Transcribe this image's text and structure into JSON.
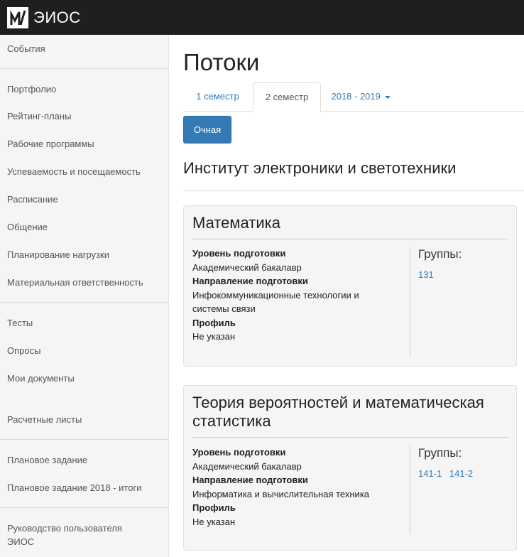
{
  "header": {
    "brand": "ЭИОС"
  },
  "sidebar": {
    "items": [
      "События",
      "Портфолио",
      "Рейтинг-планы",
      "Рабочие программы",
      "Успеваемость и посещаемость",
      "Расписание",
      "Общение",
      "Планирование нагрузки",
      "Материальная ответственность",
      "Тесты",
      "Опросы",
      "Мои документы",
      "Расчетные листы",
      "Плановое задание",
      "Плановое задание 2018 - итоги",
      "Руководство пользователя ЭИОС"
    ]
  },
  "main": {
    "title": "Потоки",
    "tabs": [
      "1 семестр",
      "2 семестр",
      "2018 - 2019"
    ],
    "active_tab": "2 семестр",
    "mode_button": "Очная",
    "institute": "Институт электроники и светотехники"
  },
  "labels": {
    "level": "Уровень подготовки",
    "direction": "Направление подготовки",
    "profile": "Профиль",
    "groups": "Группы:"
  },
  "courses": [
    {
      "title": "Математика",
      "level": "Академический бакалавр",
      "direction": "Инфокоммуникационные технологии и системы связи",
      "profile": "Не указан",
      "groups": [
        "131"
      ]
    },
    {
      "title": "Теория вероятностей и математическая статистика",
      "level": "Академический бакалавр",
      "direction": "Информатика и вычислительная техника",
      "profile": "Не указан",
      "groups": [
        "141-1",
        "141-2"
      ]
    }
  ],
  "colors": {
    "topbar": "#1f1f1f",
    "link": "#337ab7",
    "primary_button": "#337ab7"
  }
}
